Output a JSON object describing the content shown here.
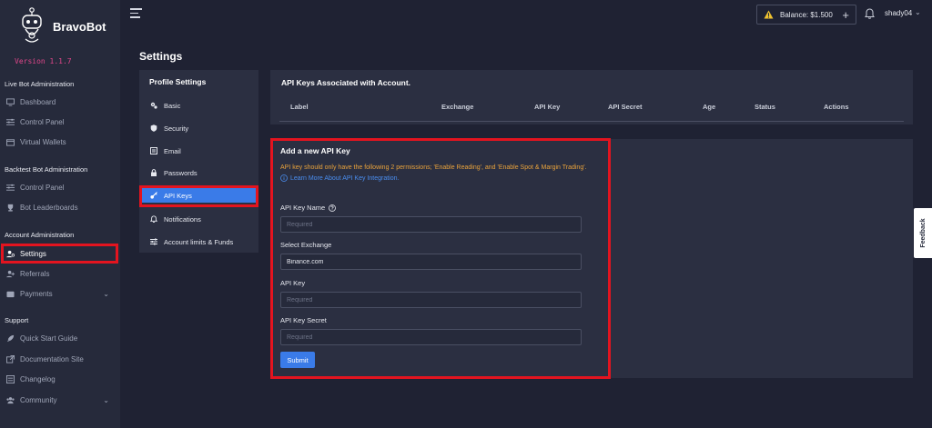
{
  "brand": {
    "name": "BravoBot",
    "version": "Version 1.1.7"
  },
  "sidebar": {
    "sections": [
      {
        "title": "Live Bot Administration"
      },
      {
        "title": "Backtest Bot Administration"
      },
      {
        "title": "Account Administration"
      },
      {
        "title": "Support"
      }
    ],
    "items": [
      {
        "label": "Dashboard",
        "icon": "monitor-icon"
      },
      {
        "label": "Control Panel",
        "icon": "sliders-icon"
      },
      {
        "label": "Virtual Wallets",
        "icon": "wallet-icon"
      },
      {
        "label": "Control Panel",
        "icon": "sliders-icon"
      },
      {
        "label": "Bot Leaderboards",
        "icon": "trophy-icon"
      },
      {
        "label": "Settings",
        "icon": "user-gear-icon"
      },
      {
        "label": "Referrals",
        "icon": "user-plus-icon"
      },
      {
        "label": "Payments",
        "icon": "wallet-icon"
      },
      {
        "label": "Quick Start Guide",
        "icon": "rocket-icon"
      },
      {
        "label": "Documentation Site",
        "icon": "external-link-icon"
      },
      {
        "label": "Changelog",
        "icon": "list-icon"
      },
      {
        "label": "Community",
        "icon": "users-icon"
      }
    ]
  },
  "topbar": {
    "balance": "Balance: $1.500",
    "user": "shady04"
  },
  "page": {
    "title": "Settings"
  },
  "profile": {
    "title": "Profile Settings",
    "items": [
      {
        "label": "Basic",
        "icon": "gears-icon"
      },
      {
        "label": "Security",
        "icon": "shield-icon"
      },
      {
        "label": "Email",
        "icon": "email-icon"
      },
      {
        "label": "Passwords",
        "icon": "lock-icon"
      },
      {
        "label": "API Keys",
        "icon": "key-icon"
      },
      {
        "label": "Notifications",
        "icon": "bell-icon"
      },
      {
        "label": "Account limits & Funds",
        "icon": "sliders-icon"
      }
    ]
  },
  "keys_table": {
    "title": "API Keys Associated with Account.",
    "columns": [
      "Label",
      "Exchange",
      "API Key",
      "API Secret",
      "Age",
      "Status",
      "Actions"
    ]
  },
  "add_key": {
    "title": "Add a new API Key",
    "permission_text": "API key should only have the following 2 permissions; 'Enable Reading', and 'Enable Spot & Margin Trading'.",
    "learn_more": "Learn More About API Key Integration.",
    "fields": {
      "name": {
        "label": "API Key Name",
        "placeholder": "Required",
        "value": ""
      },
      "exchange": {
        "label": "Select Exchange",
        "value": "Binance.com"
      },
      "key": {
        "label": "API Key",
        "placeholder": "Required",
        "value": ""
      },
      "secret": {
        "label": "API Key Secret",
        "placeholder": "Required",
        "value": ""
      }
    },
    "submit": "Submit"
  },
  "feedback": {
    "label": "Feedback"
  },
  "colors": {
    "accent": "#3a7be8",
    "highlight": "#e3141f",
    "warning": "#e8a23c",
    "version": "#e0468a"
  }
}
